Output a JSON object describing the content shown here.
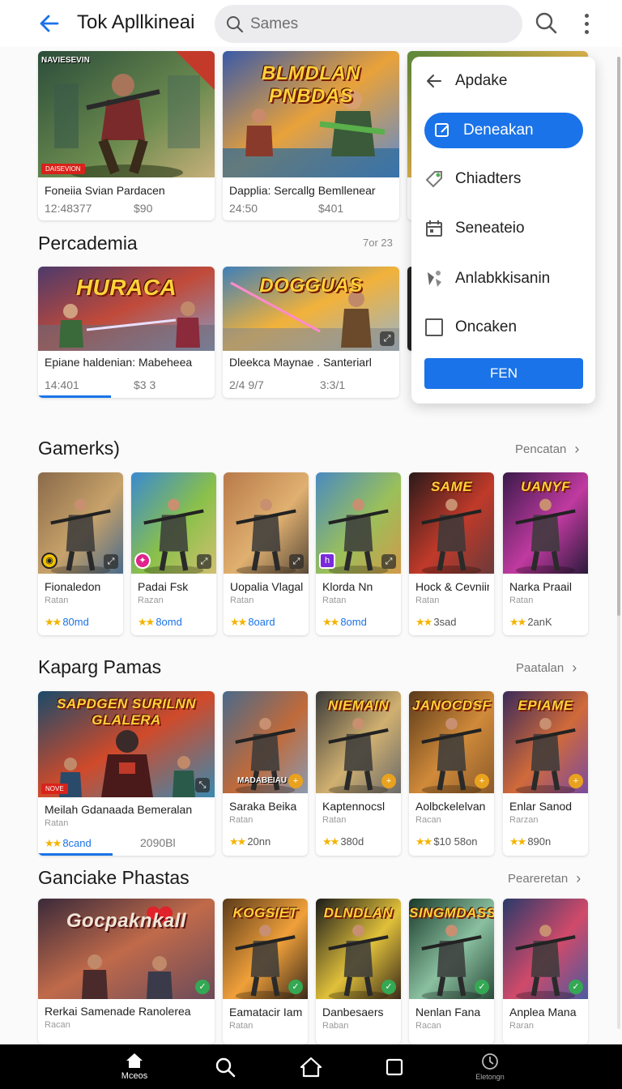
{
  "header": {
    "title": "Tok Apllkineai",
    "search_placeholder": "Sames"
  },
  "top_row": [
    {
      "name": "Foneiia Svian Pardacen",
      "meta_left": "12:48377",
      "meta_right": "$90",
      "art_title": "",
      "tag": "NAVIESEVIN",
      "badge": "DAISEVION",
      "colors": [
        "#2b4d3a",
        "#6c8b4f",
        "#c7b07a"
      ]
    },
    {
      "name": "Dapplia: Sercallg Bemllenear",
      "meta_left": "24:50",
      "meta_right": "$401",
      "art_title": "BLMDLAN PNBDAS",
      "colors": [
        "#3a5aa8",
        "#e9a23a",
        "#5d8ad0"
      ]
    },
    {
      "name": "",
      "meta_left": "",
      "meta_right": "",
      "art_title": "",
      "colors": [
        "#5c8a3a",
        "#d8b04a",
        "#2c64c8"
      ]
    }
  ],
  "section1": {
    "title": "Percademia",
    "right_text": "7or 23"
  },
  "row2": [
    {
      "name": "Epiane haldenian: Mabeheea",
      "meta_left": "14:401",
      "meta_right": "$3 3",
      "art_title": "HURACA",
      "progress": 0.41,
      "colors": [
        "#4d3a6a",
        "#c14a3a",
        "#8a9ac0"
      ]
    },
    {
      "name": "Dleekca Maynae . Santeriarl",
      "meta_left": "2/4 9/7",
      "meta_right": "3:3/1",
      "art_title": "DOGGUAS",
      "colors": [
        "#3f7fb8",
        "#f2b23a",
        "#9ab4c8"
      ]
    },
    {
      "name": "",
      "art_title": "",
      "colors": [
        "#222",
        "#444",
        "#666"
      ]
    }
  ],
  "section2": {
    "title": "Gamerks)",
    "link": "Pencatan"
  },
  "row3": [
    {
      "name": "Fionaledon",
      "sub": "Ratan",
      "rating": "80md",
      "chip": "yellow",
      "colors": [
        "#8a6a4a",
        "#c7a26a",
        "#4a6a8a"
      ]
    },
    {
      "name": "Padai Fsk",
      "sub": "Razan",
      "rating": "8omd",
      "chip": "pink",
      "colors": [
        "#3a8ad0",
        "#8ac04a",
        "#d0c070"
      ]
    },
    {
      "name": "Uopalia Vlagal",
      "sub": "Ratan",
      "rating": "8oard",
      "chip": "",
      "colors": [
        "#b87a4a",
        "#e0b070",
        "#5a4a3a"
      ]
    },
    {
      "name": "Klorda Nn",
      "sub": "Ratan",
      "rating": "8omd",
      "chip": "purple",
      "colors": [
        "#4a8ac0",
        "#9ac05a",
        "#d09a4a"
      ]
    },
    {
      "name": "Hock & Cevniin",
      "sub": "Ratan",
      "rating": "3sad",
      "art_title": "SAME",
      "colors": [
        "#2a1a1a",
        "#c03a2a",
        "#6a3a3a"
      ]
    },
    {
      "name": "Narka Praail",
      "sub": "Ratan",
      "rating": "2anK",
      "art_title": "UANYF",
      "colors": [
        "#3a1a4a",
        "#c03aa0",
        "#2a1a3a"
      ]
    }
  ],
  "section3": {
    "title": "Kaparg Pamas",
    "link": "Paatalan"
  },
  "row4": [
    {
      "name": "Meilah Gdanaada Bemeralan",
      "sub": "Ratan",
      "rating": "8cand",
      "price": "2090Bl",
      "art_title": "SAPDGEN SURILNN GLALERA",
      "badge": "NOVE",
      "progress": 0.42,
      "colors": [
        "#1a4a6a",
        "#d04a2a",
        "#3a8ab0"
      ]
    },
    {
      "name": "Saraka Beika",
      "sub": "Ratan",
      "rating": "20nn",
      "tag": "MADABEIAU",
      "colors": [
        "#4a6a8a",
        "#c06a3a",
        "#8a9ab0"
      ]
    },
    {
      "name": "Kaptennocsl",
      "sub": "Ratan",
      "rating": "380d",
      "art_title": "NIEMAIN",
      "colors": [
        "#3a3a3a",
        "#d0b070",
        "#6a6a6a"
      ]
    },
    {
      "name": "Aolbckelelvan",
      "sub": "Racan",
      "rating": "$10 58on",
      "art_title": "JANOCDSF",
      "colors": [
        "#5a3a1a",
        "#d08a3a",
        "#8a5a2a"
      ]
    },
    {
      "name": "Enlar Sanod",
      "sub": "Rarzan",
      "rating": "890n",
      "art_title": "EPIAME",
      "colors": [
        "#3a2a5a",
        "#d06a3a",
        "#7a4aa0"
      ]
    }
  ],
  "section4": {
    "title": "Ganciake Phastas",
    "link": "Peareretan"
  },
  "row5": [
    {
      "name": "Rerkai Samenade Ranolerea",
      "sub": "Racan",
      "art_title": "Gocpaknkall",
      "colors": [
        "#3a2a3a",
        "#c06a4a",
        "#6a4a5a"
      ]
    },
    {
      "name": "Eamatacir Iam",
      "sub": "Ratan",
      "art_title": "KOGSIET",
      "colors": [
        "#5a3a1a",
        "#f0a03a",
        "#3a2a1a"
      ]
    },
    {
      "name": "Danbesaers",
      "sub": "Raban",
      "art_title": "DLNDLAN",
      "colors": [
        "#1a1a1a",
        "#e0c03a",
        "#3a2a1a"
      ]
    },
    {
      "name": "Nenlan Fana",
      "sub": "Racan",
      "art_title": "SINGMDASS",
      "colors": [
        "#1a3a2a",
        "#8ac0a0",
        "#2a4a3a"
      ]
    },
    {
      "name": "Anplea Mana",
      "sub": "Raran",
      "art_title": "",
      "colors": [
        "#2a3a6a",
        "#d04a6a",
        "#4a5aa0"
      ]
    }
  ],
  "menu": {
    "back_label": "Apdake",
    "items": [
      {
        "label": "Deneakan",
        "icon": "edit-square-icon",
        "active": true
      },
      {
        "label": "Chiadters",
        "icon": "tag-icon"
      },
      {
        "label": "Seneateio",
        "icon": "calendar-icon"
      },
      {
        "label": "Anlabkkisanin",
        "icon": "shapes-icon"
      },
      {
        "label": "Oncaken",
        "icon": "checkbox-icon"
      }
    ],
    "button_label": "FEN"
  },
  "bottom_nav": [
    {
      "label": "Mceos",
      "icon": "home-filled-icon"
    },
    {
      "label": "",
      "icon": "search-icon"
    },
    {
      "label": "",
      "icon": "home-outline-icon"
    },
    {
      "label": "",
      "icon": "square-icon"
    },
    {
      "label": "Eletongn",
      "icon": "clock-icon"
    }
  ],
  "colors": {
    "accent": "#1a73e8",
    "star": "#f4b400",
    "nav_bg": "#000000"
  }
}
